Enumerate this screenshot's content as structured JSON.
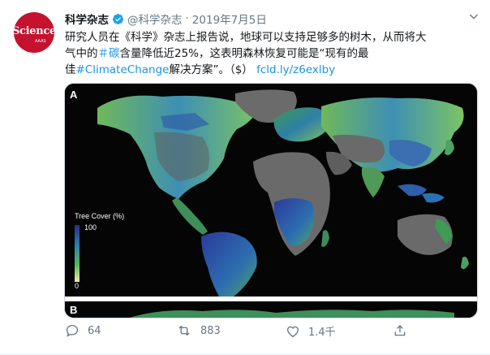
{
  "account": {
    "avatar_text": "Science",
    "avatar_sub": "AAAS",
    "name": "科学杂志",
    "handle": "@科学杂志",
    "separator": "·",
    "date": "2019年7月5日"
  },
  "tweet": {
    "line1": "研究人员在《科学》杂志上报告说，地球可以支持足够多的树木，从而将大",
    "line2_a": "气中的",
    "line2_hashtag": "＃碳",
    "line2_b": "含量降低近25%，这表明森林恢复可能是“现有的最",
    "line3_a": "佳",
    "line3_hashtag": "#ClimateChange",
    "line3_b": "解决方案”。（$） ",
    "link": "fcld.ly/z6exlby"
  },
  "media": {
    "panel_a_label": "A",
    "panel_b_label": "B",
    "legend_title": "Tree Cover (%)",
    "legend_max": "100",
    "legend_min": "0"
  },
  "actions": {
    "reply_count": "64",
    "retweet_count": "883",
    "like_count": "1.4千"
  },
  "colors": {
    "accent": "#1b95e0",
    "muted": "#657786",
    "brand": "#c4122f"
  }
}
